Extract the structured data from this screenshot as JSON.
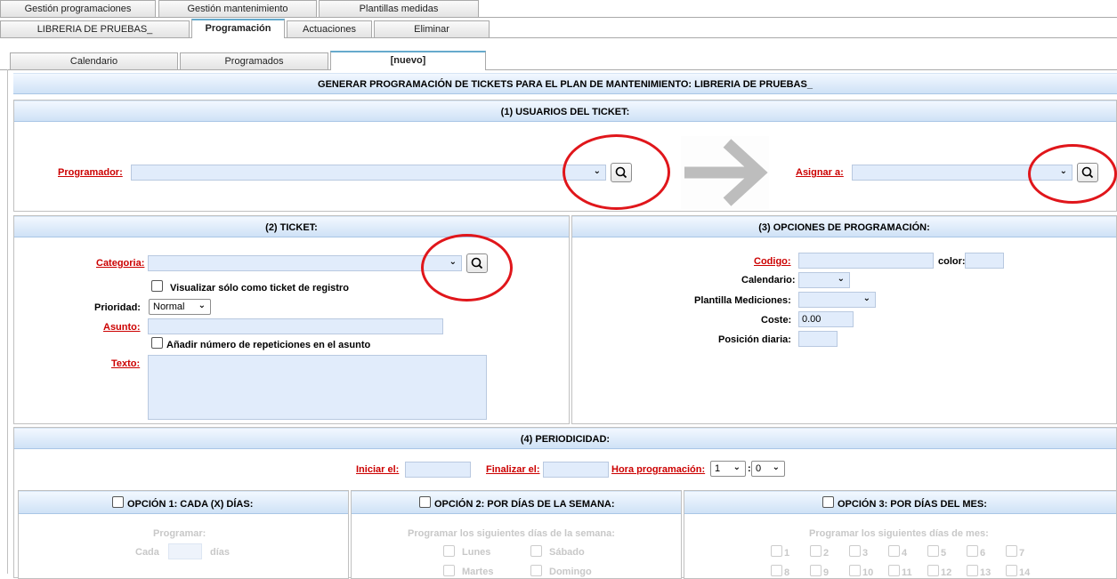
{
  "top_tabs": [
    "Gestión programaciones",
    "Gestión mantenimiento",
    "Plantillas medidas"
  ],
  "second_tabs": [
    "LIBRERIA DE PRUEBAS_",
    "Programación",
    "Actuaciones",
    "Eliminar"
  ],
  "third_tabs": [
    "Calendario",
    "Programados",
    "[nuevo]"
  ],
  "main_title": "GENERAR PROGRAMACIÓN DE TICKETS PARA EL PLAN DE MANTENIMIENTO: LIBRERIA DE PRUEBAS_",
  "section1": {
    "title": "(1) USUARIOS DEL TICKET:",
    "programador_label": "Programador:",
    "asignar_label": "Asignar a:"
  },
  "section2": {
    "title": "(2) TICKET:",
    "categoria_label": "Categoria:",
    "visualizar_label": "Visualizar sólo como ticket de registro",
    "prioridad_label": "Prioridad:",
    "prioridad_value": "Normal",
    "asunto_label": "Asunto:",
    "anadir_label": "Añadir número de repeticiones en el asunto",
    "texto_label": "Texto:"
  },
  "section3": {
    "title": "(3) OPCIONES DE PROGRAMACIÓN:",
    "codigo_label": "Codigo:",
    "color_label": "color:",
    "calendario_label": "Calendario:",
    "plantilla_label": "Plantilla Mediciones:",
    "coste_label": "Coste:",
    "coste_value": "0.00",
    "posicion_label": "Posición diaria:"
  },
  "section4": {
    "title": "(4) PERIODICIDAD:",
    "iniciar_label": "Iniciar el:",
    "finalizar_label": "Finalizar el:",
    "hora_label": "Hora programación:",
    "hora_value": "1",
    "minuto_value": "0"
  },
  "opcion1": {
    "title": "OPCIÓN 1: CADA (X) DÍAS:",
    "programar": "Programar:",
    "cada": "Cada",
    "dias": "días"
  },
  "opcion2": {
    "title": "OPCIÓN 2: POR DÍAS DE LA SEMANA:",
    "programar": "Programar los siguientes días de la semana:",
    "days": [
      "Lunes",
      "Sábado",
      "Martes",
      "Domingo"
    ]
  },
  "opcion3": {
    "title": "OPCIÓN 3: POR DÍAS DEL MES:",
    "programar": "Programar los siguientes días de mes:",
    "days": [
      "1",
      "2",
      "3",
      "4",
      "5",
      "6",
      "7",
      "8",
      "9",
      "10",
      "11",
      "12",
      "13",
      "14"
    ]
  },
  "colors": {
    "required": "#cc0000",
    "input_bg": "#e1ecfb",
    "header_bg": "#cfe2f6",
    "annotation_ring": "#e0161b",
    "arrow": "#bdbdbd"
  }
}
